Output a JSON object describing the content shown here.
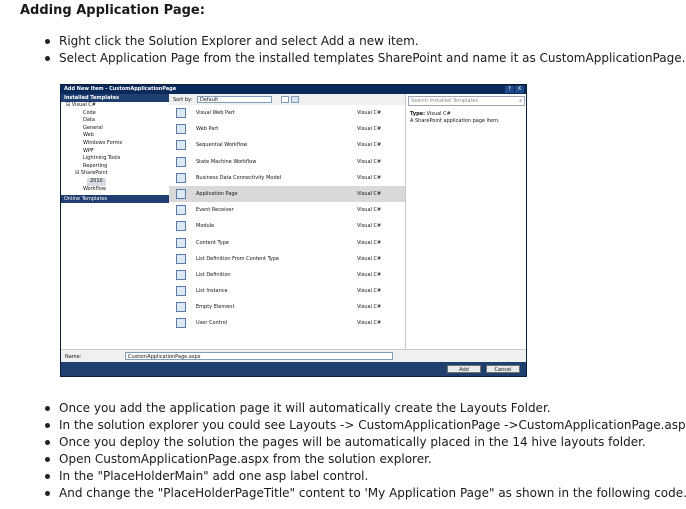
{
  "heading": "Adding Application Page:",
  "steps_before": [
    "Right click the Solution Explorer and select Add a new item.",
    "Select Application Page from the installed templates SharePoint and name it as CustomApplicationPage."
  ],
  "steps_after": [
    "Once you add the application page it will automatically create the Layouts Folder.",
    "In the solution explorer you could see Layouts -> CustomApplicationPage ->CustomApplicationPage.aspx.",
    "Once you deploy the solution the pages will be automatically placed in the 14 hive layouts folder.",
    "Open CustomApplicationPage.aspx from the solution explorer.",
    "In the \"PlaceHolderMain\" add one asp label control.",
    "And change the \"PlaceHolderPageTitle\" content to 'My Application Page\" as shown in the following code."
  ],
  "dialog": {
    "title": "Add New Item - CustomApplicationPage",
    "window_buttons": [
      "?",
      "X"
    ],
    "installed_templates_header": "Installed Templates",
    "tree": [
      "Visual C#",
      "Code",
      "Data",
      "General",
      "Web",
      "Windows Forms",
      "WPF",
      "Lightning Tools",
      "Reporting",
      "SharePoint",
      "2010",
      "Workflow"
    ],
    "online_templates": "Online Templates",
    "sort_by_label": "Sort by:",
    "sort_by_value": "Default",
    "search_placeholder": "Search Installed Templates",
    "items": [
      {
        "name": "Visual Web Part",
        "lang": "Visual C#"
      },
      {
        "name": "Web Part",
        "lang": "Visual C#"
      },
      {
        "name": "Sequential Workflow",
        "lang": "Visual C#"
      },
      {
        "name": "State Machine Workflow",
        "lang": "Visual C#"
      },
      {
        "name": "Business Data Connectivity Model",
        "lang": "Visual C#"
      },
      {
        "name": "Application Page",
        "lang": "Visual C#"
      },
      {
        "name": "Event Receiver",
        "lang": "Visual C#"
      },
      {
        "name": "Module",
        "lang": "Visual C#"
      },
      {
        "name": "Content Type",
        "lang": "Visual C#"
      },
      {
        "name": "List Definition From Content Type",
        "lang": "Visual C#"
      },
      {
        "name": "List Definition",
        "lang": "Visual C#"
      },
      {
        "name": "List Instance",
        "lang": "Visual C#"
      },
      {
        "name": "Empty Element",
        "lang": "Visual C#"
      },
      {
        "name": "User Control",
        "lang": "Visual C#"
      }
    ],
    "selected_item": "Application Page",
    "type_label": "Type:",
    "type_value": "Visual C#",
    "description": "A SharePoint application page item.",
    "name_label": "Name:",
    "name_value": "CustomApplicationPage.aspx",
    "add_button": "Add",
    "cancel_button": "Cancel"
  }
}
